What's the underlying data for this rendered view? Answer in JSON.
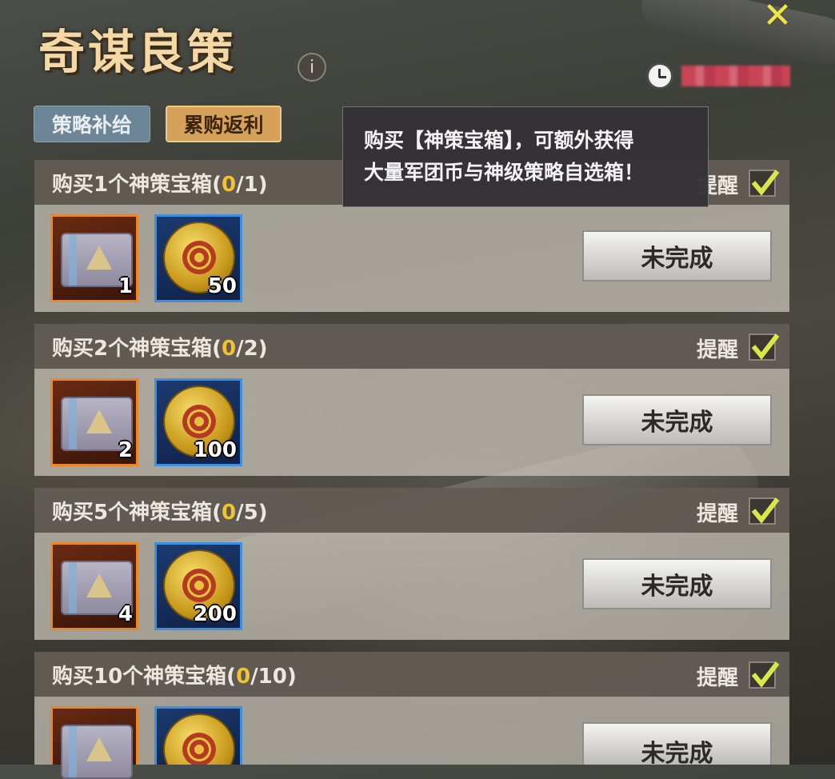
{
  "header": {
    "title": "奇谋良策",
    "info_icon": "i",
    "close_icon": "✕"
  },
  "tabs": [
    {
      "label": "策略补给",
      "active": false
    },
    {
      "label": "累购返利",
      "active": true
    }
  ],
  "tooltip": {
    "line1": "购买【神策宝箱】，可额外获得",
    "line2": "大量军团币与神级策略自选箱！"
  },
  "tasks": [
    {
      "prefix": "购买1个神策宝箱(",
      "current": "0",
      "suffix": "/1)",
      "remind": "提醒",
      "chest_qty": "1",
      "coin_qty": "50",
      "status": "未完成"
    },
    {
      "prefix": "购买2个神策宝箱(",
      "current": "0",
      "suffix": "/2)",
      "remind": "提醒",
      "chest_qty": "2",
      "coin_qty": "100",
      "status": "未完成"
    },
    {
      "prefix": "购买5个神策宝箱(",
      "current": "0",
      "suffix": "/5)",
      "remind": "提醒",
      "chest_qty": "4",
      "coin_qty": "200",
      "status": "未完成"
    },
    {
      "prefix": "购买10个神策宝箱(",
      "current": "0",
      "suffix": "/10)",
      "remind": "提醒",
      "chest_qty": "",
      "coin_qty": "",
      "status": "未完成"
    }
  ],
  "colors": {
    "title": "#f4d9a6",
    "progress_current": "#f2c230",
    "close": "#f2e54a",
    "checkmark": "#d8e84a"
  },
  "icons": {
    "clock": "clock-icon",
    "check": "checkmark-icon",
    "chest": "strategy-chest-icon",
    "coin": "legion-coin-icon"
  }
}
